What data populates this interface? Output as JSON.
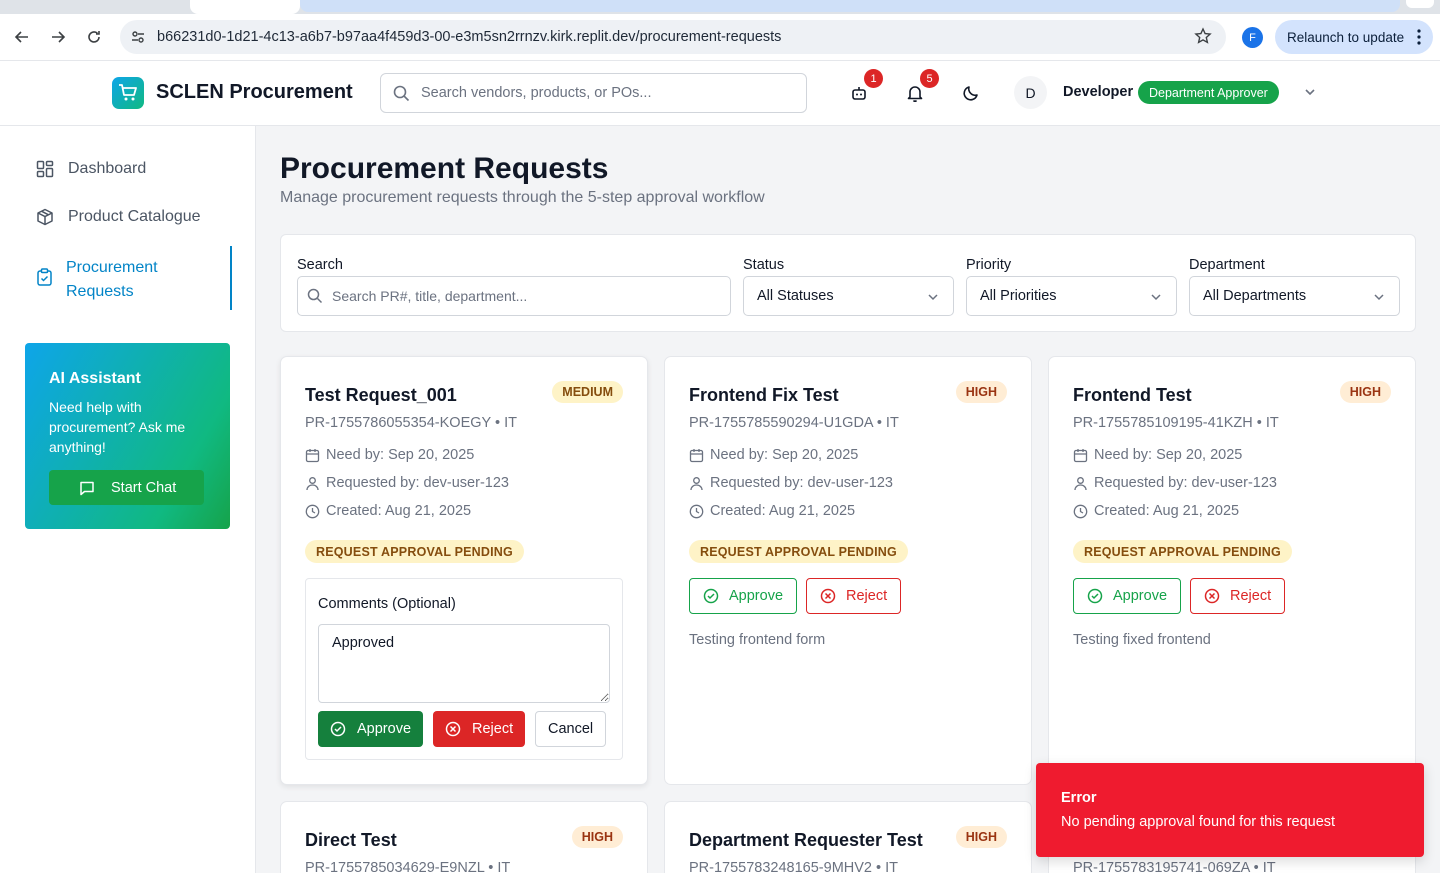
{
  "browser": {
    "url": "b66231d0-1d21-4c13-a6b7-b97aa4f459d3-00-e3m5sn2rrnzv.kirk.replit.dev/procurement-requests",
    "profile_initial": "F",
    "relaunch_label": "Relaunch to update"
  },
  "header": {
    "brand": "SCLEN Procurement",
    "search_placeholder": "Search vendors, products, or POs...",
    "assistant_count": "1",
    "notification_count": "5",
    "avatar_initial": "D",
    "user_name": "Developer",
    "role": "Department Approver"
  },
  "sidebar": {
    "items": [
      {
        "label": "Dashboard",
        "icon": "dashboard-grid-icon"
      },
      {
        "label": "Product Catalogue",
        "icon": "package-icon"
      },
      {
        "label": "Procurement Requests",
        "icon": "clipboard-check-icon"
      }
    ],
    "ai": {
      "title": "AI Assistant",
      "desc": "Need help with procurement? Ask me anything!",
      "button": "Start Chat"
    }
  },
  "page": {
    "title": "Procurement Requests",
    "subtitle": "Manage procurement requests through the 5-step approval workflow"
  },
  "filters": {
    "search_label": "Search",
    "search_placeholder": "Search PR#, title, department...",
    "status_label": "Status",
    "status_value": "All Statuses",
    "priority_label": "Priority",
    "priority_value": "All Priorities",
    "department_label": "Department",
    "department_value": "All Departments"
  },
  "labels": {
    "comments": "Comments (Optional)",
    "approve": "Approve",
    "reject": "Reject",
    "cancel": "Cancel"
  },
  "requests": [
    {
      "title": "Test Request_001",
      "priority": "MEDIUM",
      "id_dept": "PR-1755786055354-KOEGY • IT",
      "need_by": "Need by: Sep 20, 2025",
      "requested_by": "Requested by: dev-user-123",
      "created": "Created: Aug 21, 2025",
      "status": "REQUEST APPROVAL PENDING",
      "comment": "Approved"
    },
    {
      "title": "Frontend Fix Test",
      "priority": "HIGH",
      "id_dept": "PR-1755785590294-U1GDA • IT",
      "need_by": "Need by: Sep 20, 2025",
      "requested_by": "Requested by: dev-user-123",
      "created": "Created: Aug 21, 2025",
      "status": "REQUEST APPROVAL PENDING",
      "description": "Testing frontend form"
    },
    {
      "title": "Frontend Test",
      "priority": "HIGH",
      "id_dept": "PR-1755785109195-41KZH • IT",
      "need_by": "Need by: Sep 20, 2025",
      "requested_by": "Requested by: dev-user-123",
      "created": "Created: Aug 21, 2025",
      "status": "REQUEST APPROVAL PENDING",
      "description": "Testing fixed frontend"
    },
    {
      "title": "Direct Test",
      "priority": "HIGH",
      "id_dept": "PR-1755785034629-E9NZL • IT"
    },
    {
      "title": "Department Requester Test",
      "priority": "HIGH",
      "id_dept": "PR-1755783248165-9MHV2 • IT"
    },
    {
      "id_dept": "PR-1755783195741-069ZA • IT"
    }
  ],
  "toast": {
    "title": "Error",
    "message": "No pending approval found for this request"
  },
  "colors": {
    "brand": "#0284c7",
    "approve": "#16a34a",
    "reject": "#dc2626",
    "toast": "#ef1b2f"
  }
}
